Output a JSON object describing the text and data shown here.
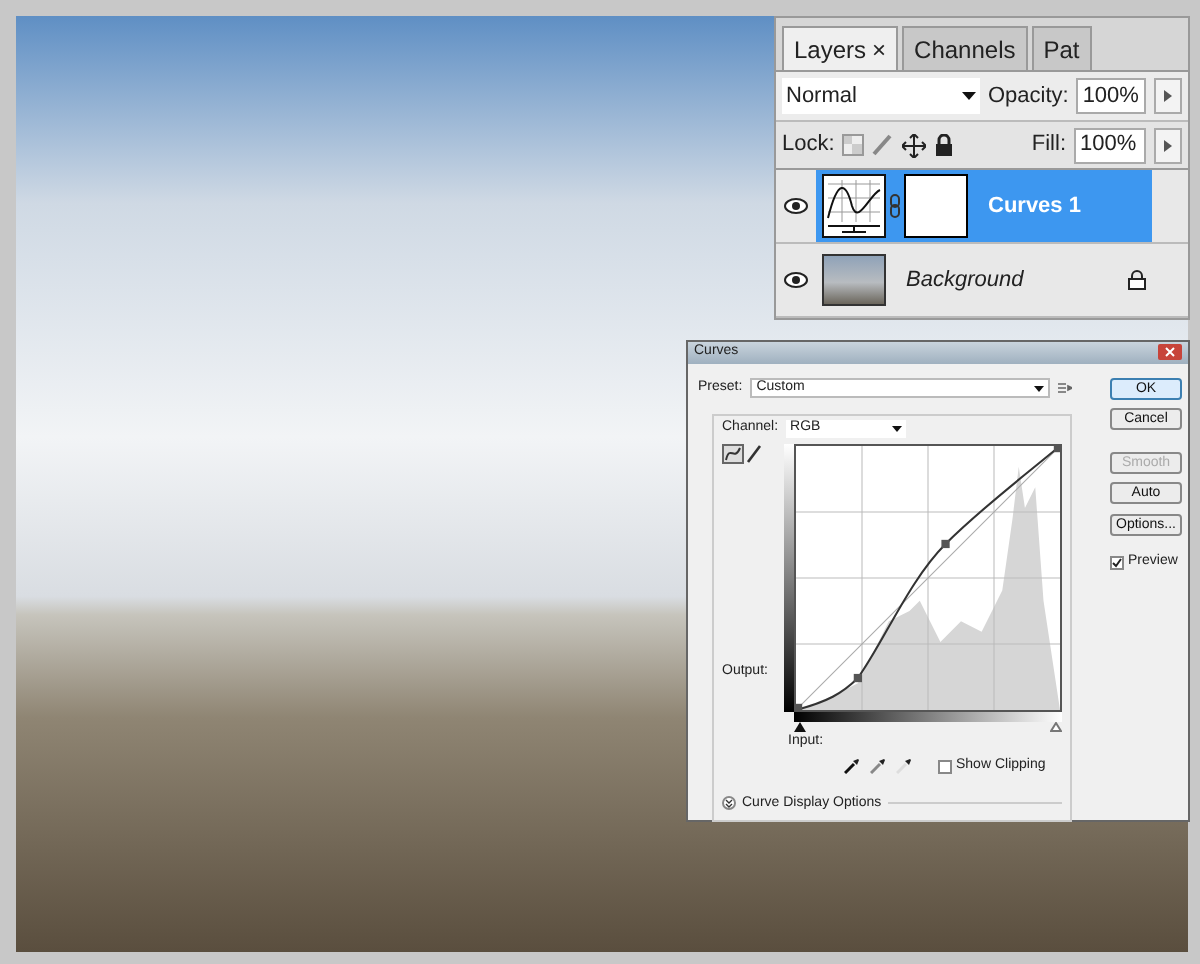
{
  "layers_panel": {
    "tabs": [
      {
        "label": "Layers",
        "selected": true,
        "close": "×"
      },
      {
        "label": "Channels",
        "selected": false
      },
      {
        "label": "Pat",
        "selected": false
      }
    ],
    "blend_mode": "Normal",
    "opacity_label": "Opacity:",
    "opacity": "100%",
    "lock_label": "Lock:",
    "fill_label": "Fill:",
    "fill": "100%",
    "layers": [
      {
        "name": "Curves 1",
        "kind": "adjustment",
        "visible": true,
        "selected": true,
        "locked": false
      },
      {
        "name": "Background",
        "kind": "image",
        "visible": true,
        "selected": false,
        "locked": true
      }
    ]
  },
  "curves_dialog": {
    "title": "Curves",
    "preset_label": "Preset:",
    "preset": "Custom",
    "channel_label": "Channel:",
    "channel": "RGB",
    "output_label": "Output:",
    "input_label": "Input:",
    "show_clipping": {
      "label": "Show Clipping",
      "checked": false
    },
    "display_options": "Curve Display Options",
    "buttons": [
      {
        "label": "OK",
        "default": true,
        "disabled": false
      },
      {
        "label": "Cancel",
        "default": false,
        "disabled": false
      },
      {
        "label": "Smooth",
        "default": false,
        "disabled": true
      },
      {
        "label": "Auto",
        "default": false,
        "disabled": false
      },
      {
        "label": "Options...",
        "default": false,
        "disabled": false
      }
    ],
    "preview": {
      "label": "Preview",
      "checked": true
    }
  }
}
